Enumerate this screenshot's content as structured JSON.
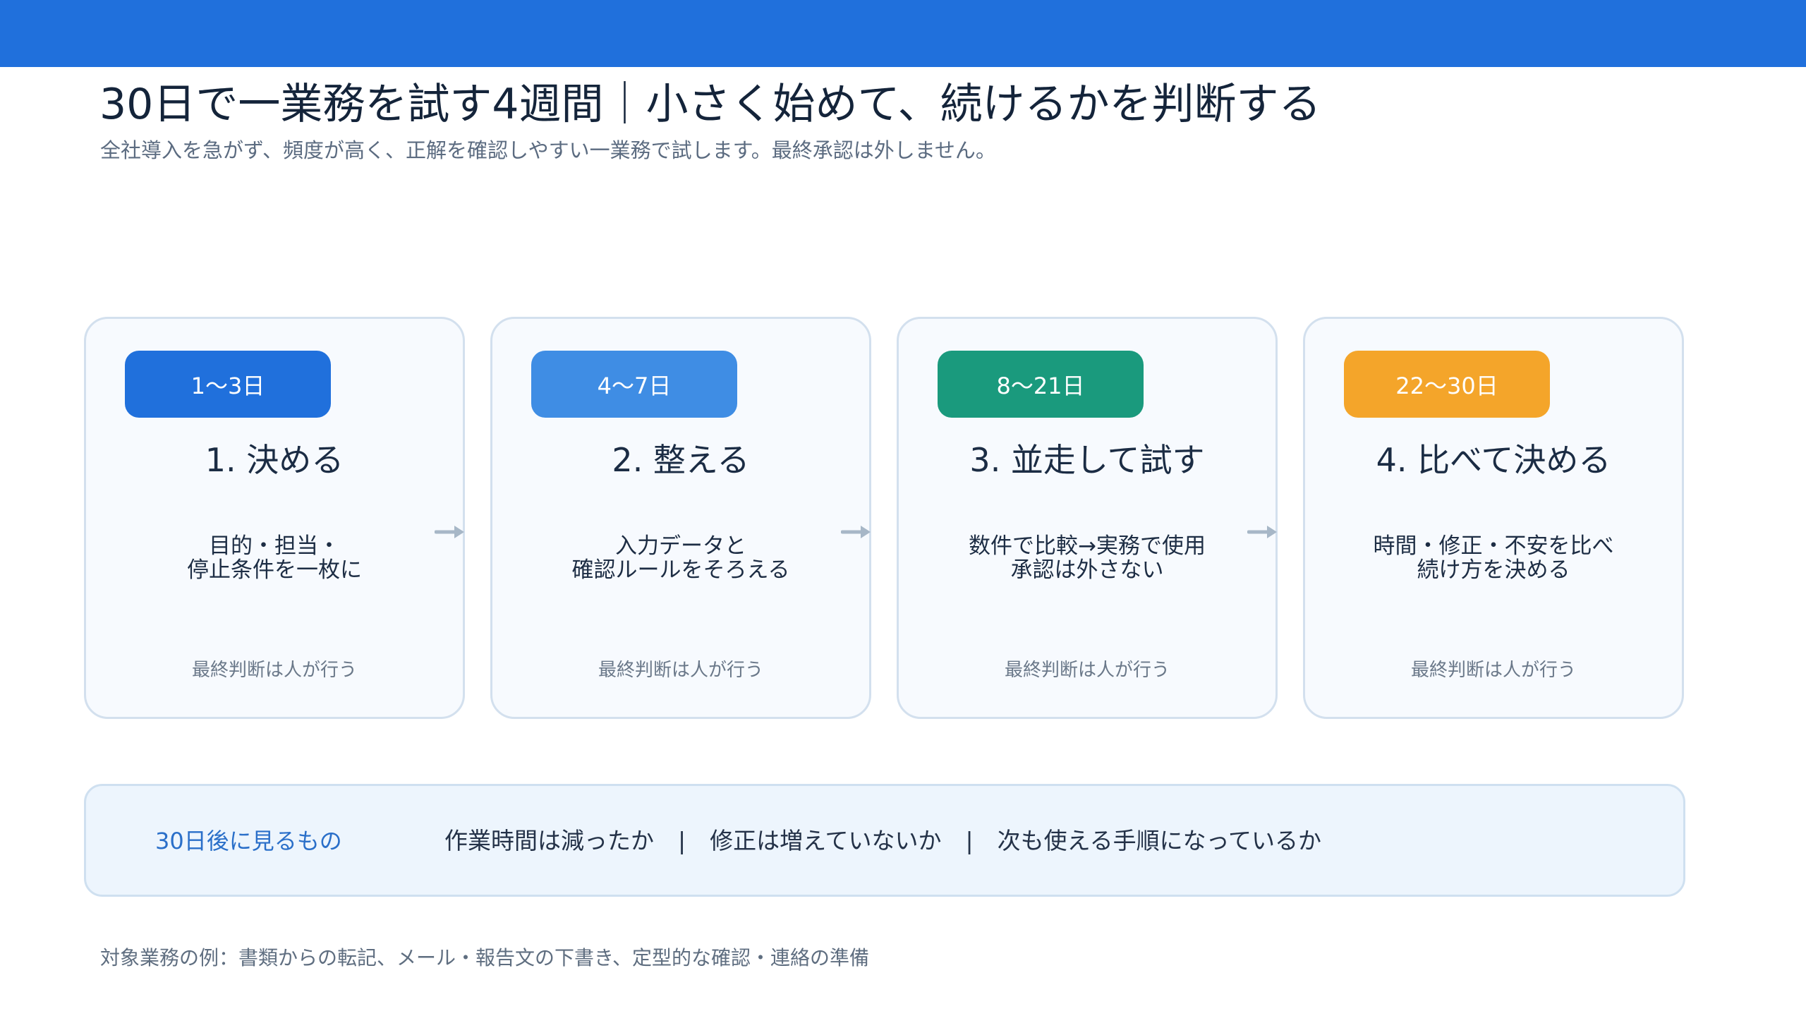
{
  "header": {
    "title": "30日で一業務を試す4週間｜小さく始めて、続けるかを判断する",
    "subtitle": "全社導入を急がず、頻度が高く、正解を確認しやすい一業務で試します。最終承認は外しません。"
  },
  "steps": [
    {
      "period": "1〜3日",
      "title": "1. 決める",
      "desc": "目的・担当・\n停止条件を一枚に",
      "note": "最終判断は人が行う",
      "color": "#2070dc"
    },
    {
      "period": "4〜7日",
      "title": "2. 整える",
      "desc": "入力データと\n確認ルールをそろえる",
      "note": "最終判断は人が行う",
      "color": "#3f8de4"
    },
    {
      "period": "8〜21日",
      "title": "3. 並走して試す",
      "desc": "数件で比較→実務で使用\n承認は外さない",
      "note": "最終判断は人が行う",
      "color": "#1a9a7d"
    },
    {
      "period": "22〜30日",
      "title": "4. 比べて決める",
      "desc": "時間・修正・不安を比べ\n続け方を決める",
      "note": "最終判断は人が行う",
      "color": "#f4a52a"
    }
  ],
  "summary": {
    "label": "30日後に見るもの",
    "items": [
      "作業時間は減ったか",
      "修正は増えていないか",
      "次も使える手順になっているか"
    ],
    "separator": "|"
  },
  "footer": "対象業務の例：書類からの転記、メール・報告文の下書き、定型的な確認・連絡の準備",
  "colors": {
    "accent": "#2070dc",
    "arrow": "#a7b7c7"
  }
}
